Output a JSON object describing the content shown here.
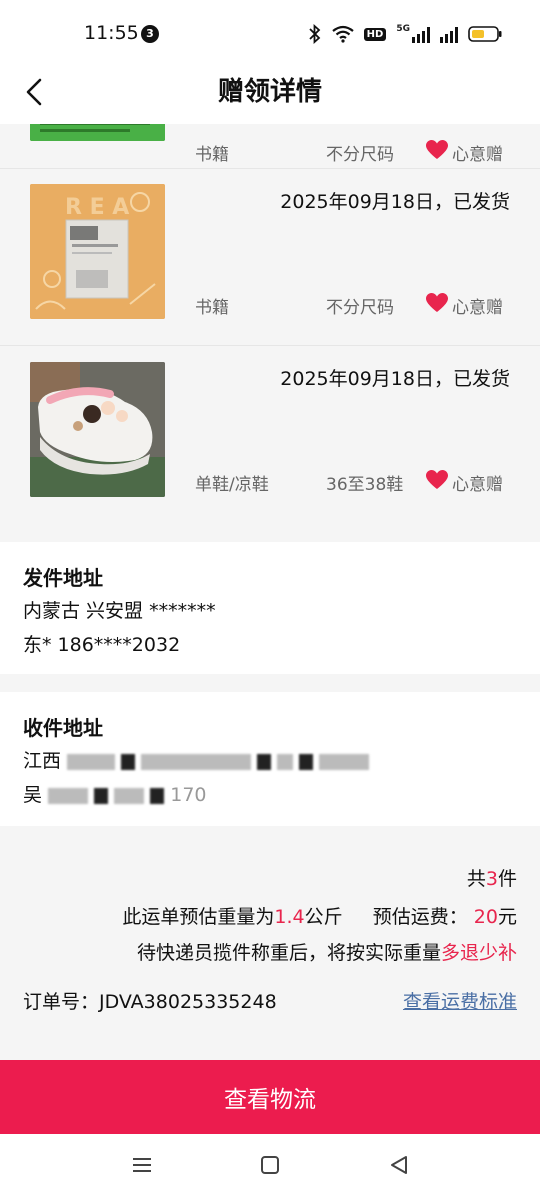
{
  "status_bar": {
    "time": "11:55",
    "notification_count": "3",
    "icons": [
      "bluetooth-icon",
      "wifi-icon",
      "hd-icon",
      "signal-5g-icon",
      "signal-icon",
      "battery-icon"
    ],
    "hd_label": "HD",
    "net_label": "5G"
  },
  "header": {
    "title": "赠领详情",
    "back_icon": "chevron-left-icon"
  },
  "items": [
    {
      "date": "",
      "category": "书籍",
      "size": "不分尺码",
      "gift_label": "心意赠",
      "image": "green book cover (partially visible)"
    },
    {
      "date": "2025年09月18日，已发货",
      "category": "书籍",
      "size": "不分尺码",
      "gift_label": "心意赠",
      "image": "orange book cover"
    },
    {
      "date": "2025年09月18日，已发货",
      "category": "单鞋/凉鞋",
      "size": "36至38鞋",
      "gift_label": "心意赠",
      "image": "white clog shoes"
    }
  ],
  "sender": {
    "title": "发件地址",
    "address": "内蒙古 兴安盟 *******",
    "contact": "东* 186****2032"
  },
  "receiver": {
    "title": "收件地址",
    "address_prefix": "江西",
    "contact_prefix": "吴",
    "contact_suffix": "170"
  },
  "summary": {
    "count_prefix": "共",
    "count": "3",
    "count_suffix": "件",
    "weight_prefix": "此运单预估重量为",
    "weight": "1.4",
    "weight_unit": "公斤",
    "fee_label": "预估运费：",
    "fee": "20",
    "fee_unit": "元",
    "note_prefix": "待快递员揽件称重后，将按实际重量",
    "note_highlight": "多退少补",
    "order_label": "订单号：JDVA38025335248",
    "fee_standard_link": "查看运费标准"
  },
  "actions": {
    "logistics_button": "查看物流"
  },
  "system_nav": {
    "icons": [
      "menu-icon",
      "home-icon",
      "back-triangle-icon"
    ]
  },
  "colors": {
    "accent": "#ec1c4e",
    "highlight_red": "#e8254d",
    "link_blue": "#4a6fa5",
    "heart": "#e8254d",
    "background": "#f5f5f5"
  }
}
